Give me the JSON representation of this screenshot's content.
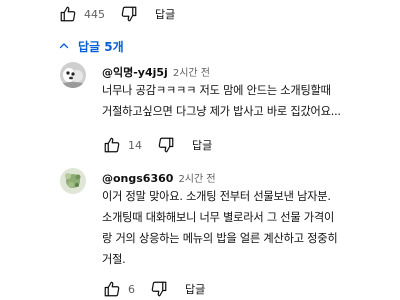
{
  "top_comment": {
    "like_count": "445",
    "reply_label": "답글"
  },
  "replies_toggle": {
    "label": "답글 5개"
  },
  "replies": [
    {
      "author": "@익명-y4j5j",
      "time": "2시간 전",
      "lines": [
        "너무나 공감ㅋㅋㅋㅋ 저도 맘에 안드는 소개팅할때",
        "거절하고싶으면 다그냥 제가 밥사고 바로 집갔어요..."
      ],
      "like_count": "14",
      "reply_label": "답글"
    },
    {
      "author": "@ongs6360",
      "time": "2시간 전",
      "lines": [
        "이거 정말 맞아요. 소개팅 전부터 선물보낸 남자분.",
        "소개팅때 대화해보니 너무 별로라서 그 선물 가격이",
        "랑 거의 상응하는 메뉴의 밥을 얼른 계산하고 정중히",
        "거절."
      ],
      "like_count": "6",
      "reply_label": "답글"
    }
  ],
  "colors": {
    "link_blue": "#065fd4",
    "text": "#0f0f0f",
    "secondary": "#606060"
  }
}
